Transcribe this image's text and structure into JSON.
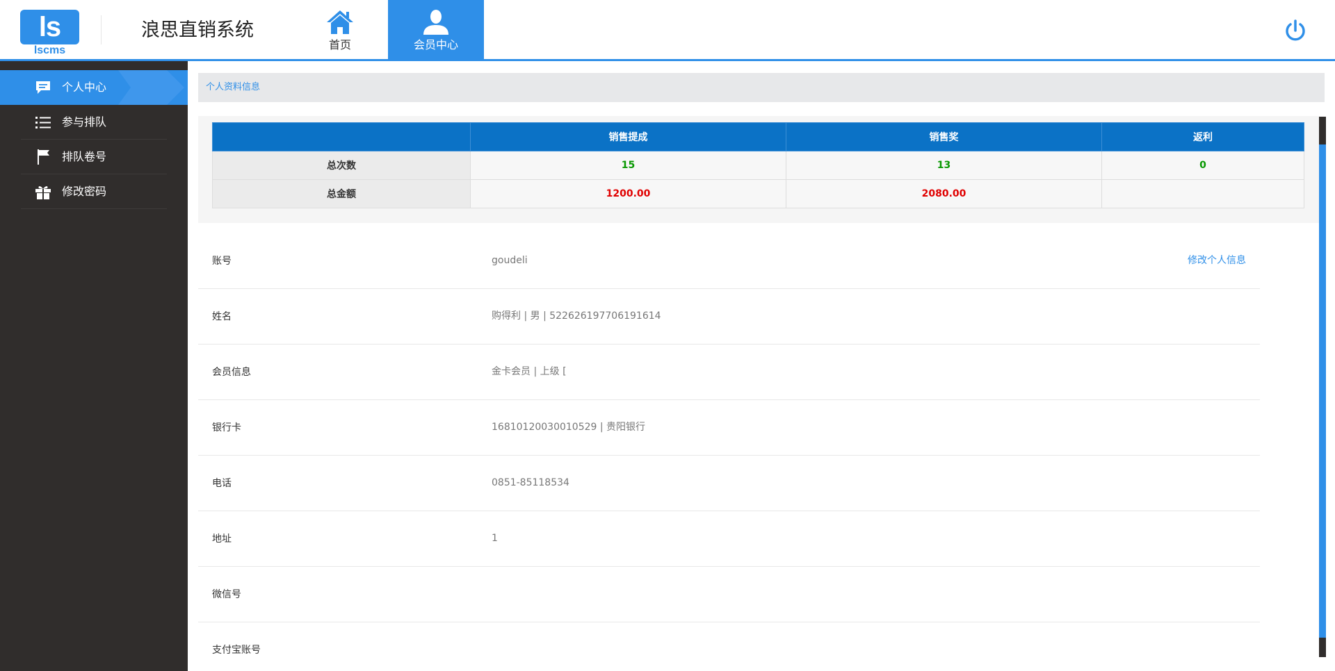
{
  "header": {
    "logo_text": "ls",
    "logo_sub": "lscms",
    "app_title": "浪思直销系统",
    "nav": [
      {
        "label": "首页",
        "icon": "home-icon"
      },
      {
        "label": "会员中心",
        "icon": "user-icon",
        "active": true
      }
    ],
    "power_icon": "power-icon",
    "accent_color": "#2f8fe8"
  },
  "sidebar": {
    "items": [
      {
        "label": "个人中心",
        "icon": "chat-icon",
        "active": true
      },
      {
        "label": "参与排队",
        "icon": "list-icon"
      },
      {
        "label": "排队卷号",
        "icon": "flag-icon"
      },
      {
        "label": "修改密码",
        "icon": "gift-icon"
      }
    ]
  },
  "breadcrumb": {
    "label": "个人资料信息"
  },
  "stats": {
    "headers": [
      "",
      "销售提成",
      "销售奖",
      "返利"
    ],
    "rows": [
      {
        "label": "总次数",
        "values": [
          "15",
          "13",
          "0"
        ]
      },
      {
        "label": "总金额",
        "values": [
          "1200.00",
          "2080.00",
          ""
        ]
      }
    ]
  },
  "profile": {
    "edit_link": "修改个人信息",
    "rows": [
      {
        "key": "账号",
        "value": "goudeli"
      },
      {
        "key": "姓名",
        "value": "购得利 | 男 | 522626197706191614"
      },
      {
        "key": "会员信息",
        "value": "金卡会员 | 上级 ["
      },
      {
        "key": "银行卡",
        "value": "16810120030010529 | 贵阳银行"
      },
      {
        "key": "电话",
        "value": "0851-85118534"
      },
      {
        "key": "地址",
        "value": "1"
      },
      {
        "key": "微信号",
        "value": ""
      },
      {
        "key": "支付宝账号",
        "value": ""
      }
    ]
  }
}
